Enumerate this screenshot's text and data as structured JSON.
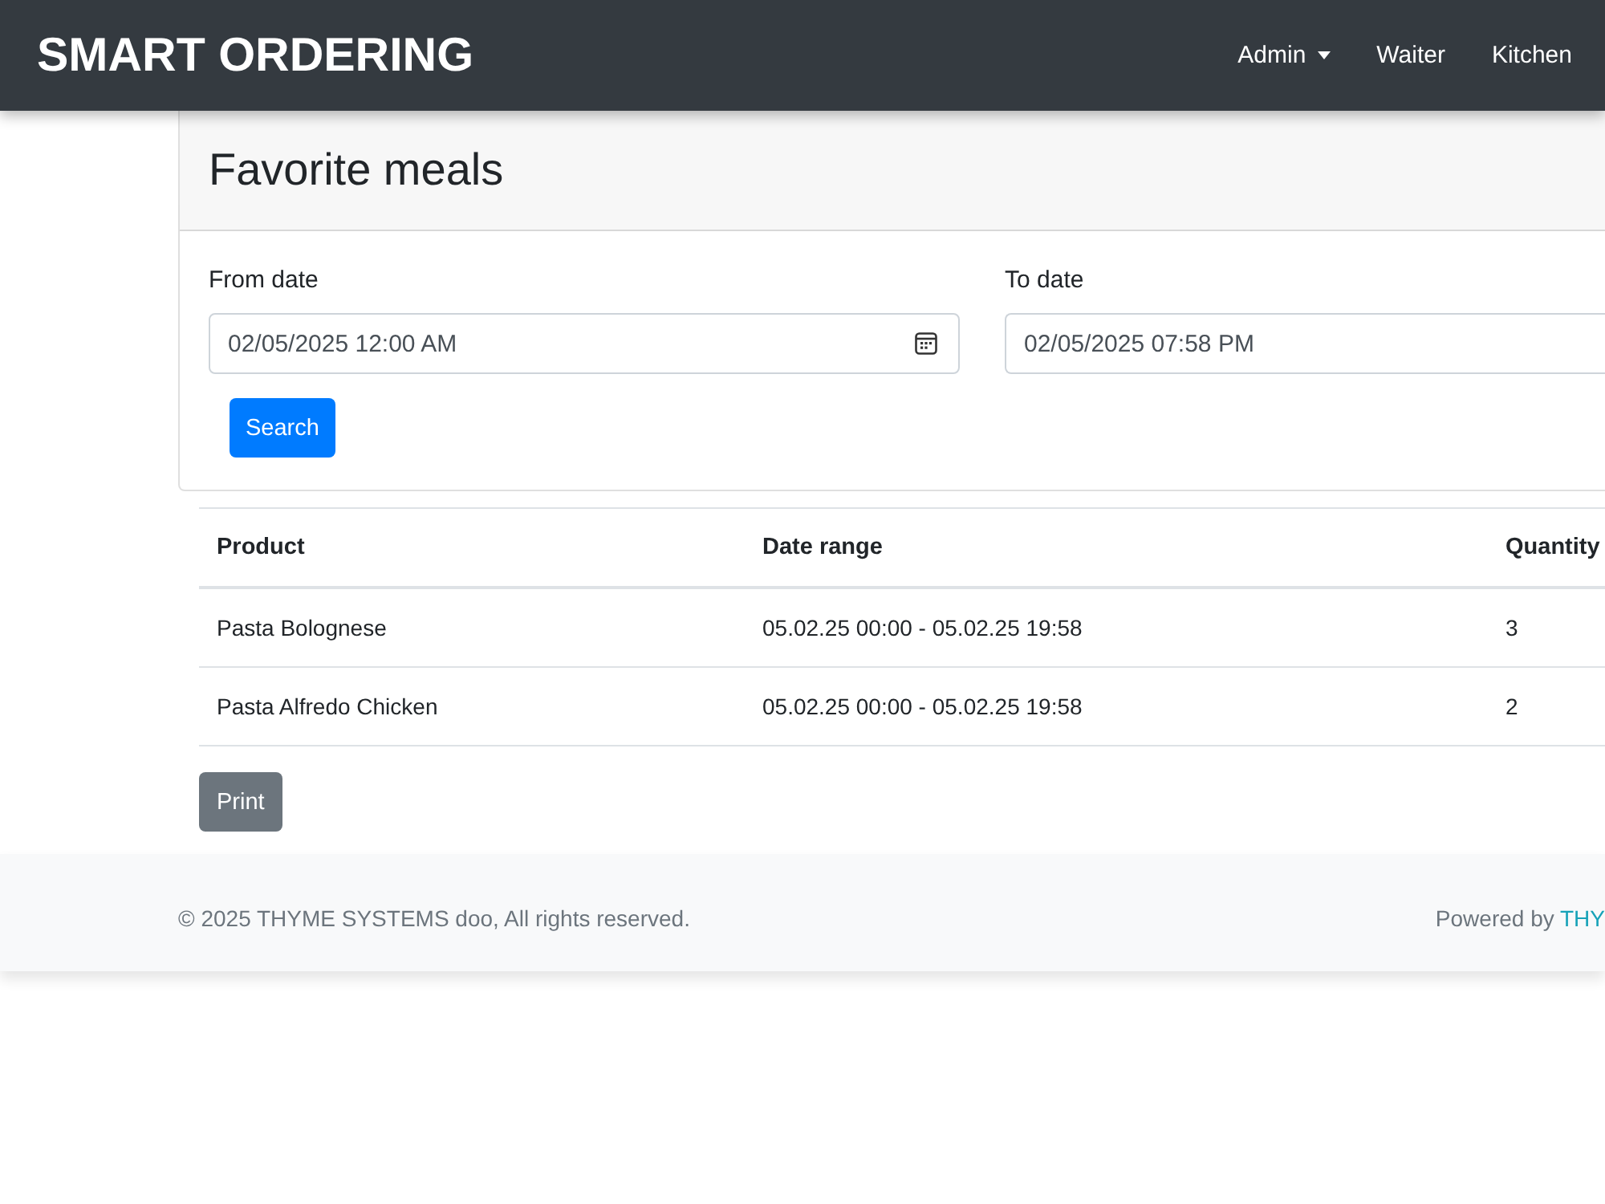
{
  "navbar": {
    "brand": "SMART ORDERING",
    "links": [
      {
        "label": "Admin",
        "kind": "dropdown"
      },
      {
        "label": "Waiter",
        "kind": "link"
      },
      {
        "label": "Kitchen",
        "kind": "link"
      }
    ]
  },
  "card": {
    "title": "Favorite meals",
    "fields": [
      {
        "label": "From date",
        "value": "02/05/2025 12:00 AM",
        "picker_icon": true
      },
      {
        "label": "To date",
        "value": "02/05/2025 07:58 PM",
        "picker_icon": false
      }
    ],
    "button": "Search"
  },
  "table": {
    "columns": [
      "Product",
      "Date range",
      "Quantity"
    ],
    "rows": [
      [
        "Pasta Bolognese",
        "05.02.25 00:00 - 05.02.25 19:58",
        "3"
      ],
      [
        "Pasta Alfredo Chicken",
        "05.02.25 00:00 - 05.02.25 19:58",
        "2"
      ]
    ]
  },
  "print_button": "Print",
  "footer": {
    "copyright": "© 2025 THYME SYSTEMS doo, All rights reserved.",
    "powered_by": "Powered by",
    "link": "THY"
  }
}
